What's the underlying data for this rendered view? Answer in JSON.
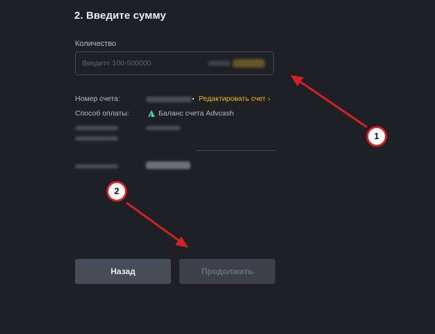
{
  "step_title": "2. Введите сумму",
  "amount": {
    "label": "Количество",
    "placeholder": "Введите 100-500000",
    "value": ""
  },
  "details": {
    "account_label": "Номер счета:",
    "edit_link": "Редактировать счет",
    "edit_chevron": "›",
    "payment_label": "Способ оплаты:",
    "payment_method": "Баланс счета Advcash",
    "payment_icon": "advcash-logo-icon"
  },
  "buttons": {
    "back": "Назад",
    "continue": "Продолжить"
  },
  "annotations": {
    "marker_1": "1",
    "marker_2": "2",
    "arrow_color": "#d42222"
  },
  "colors": {
    "accent": "#f0b90b",
    "background": "#1e2026",
    "advcash": "#2ecc9a"
  }
}
